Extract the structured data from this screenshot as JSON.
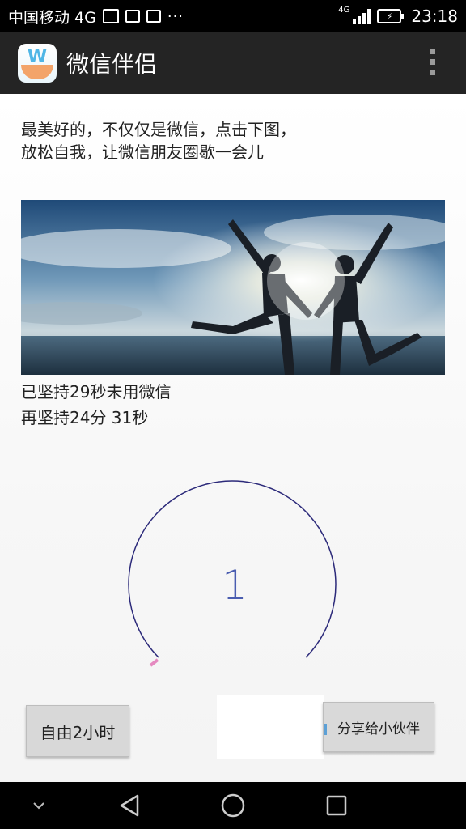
{
  "status_bar": {
    "carrier": "中国移动 4G",
    "network": "4G",
    "time": "23:18",
    "icons": [
      "gallery-icon",
      "keyboard-icon",
      "copy-icon",
      "more-dots-icon"
    ]
  },
  "app_bar": {
    "title": "微信伴侣",
    "logo_icon": "wechat-companion-logo-icon",
    "menu_icon": "overflow-menu-icon"
  },
  "main": {
    "intro_text": "最美好的，不仅仅是微信，点击下图，\n 放松自我，让微信朋友圈歇一会儿",
    "photo_icon": "couple-jumping-beach-photo",
    "status_elapsed": "已坚持29秒未用微信",
    "status_remaining": "再坚持24分 31秒",
    "counter": "1",
    "button_free": "自由2小时",
    "button_share": "分享给小伙伴"
  },
  "colors": {
    "status_bar_bg": "#000000",
    "app_bar_bg": "#242424",
    "dial_ring": "#2c2a7a",
    "dial_tick": "#e58ac0"
  },
  "nav_bar": {
    "icons": [
      "chevron-down-icon",
      "back-icon",
      "home-icon",
      "recents-icon"
    ]
  }
}
